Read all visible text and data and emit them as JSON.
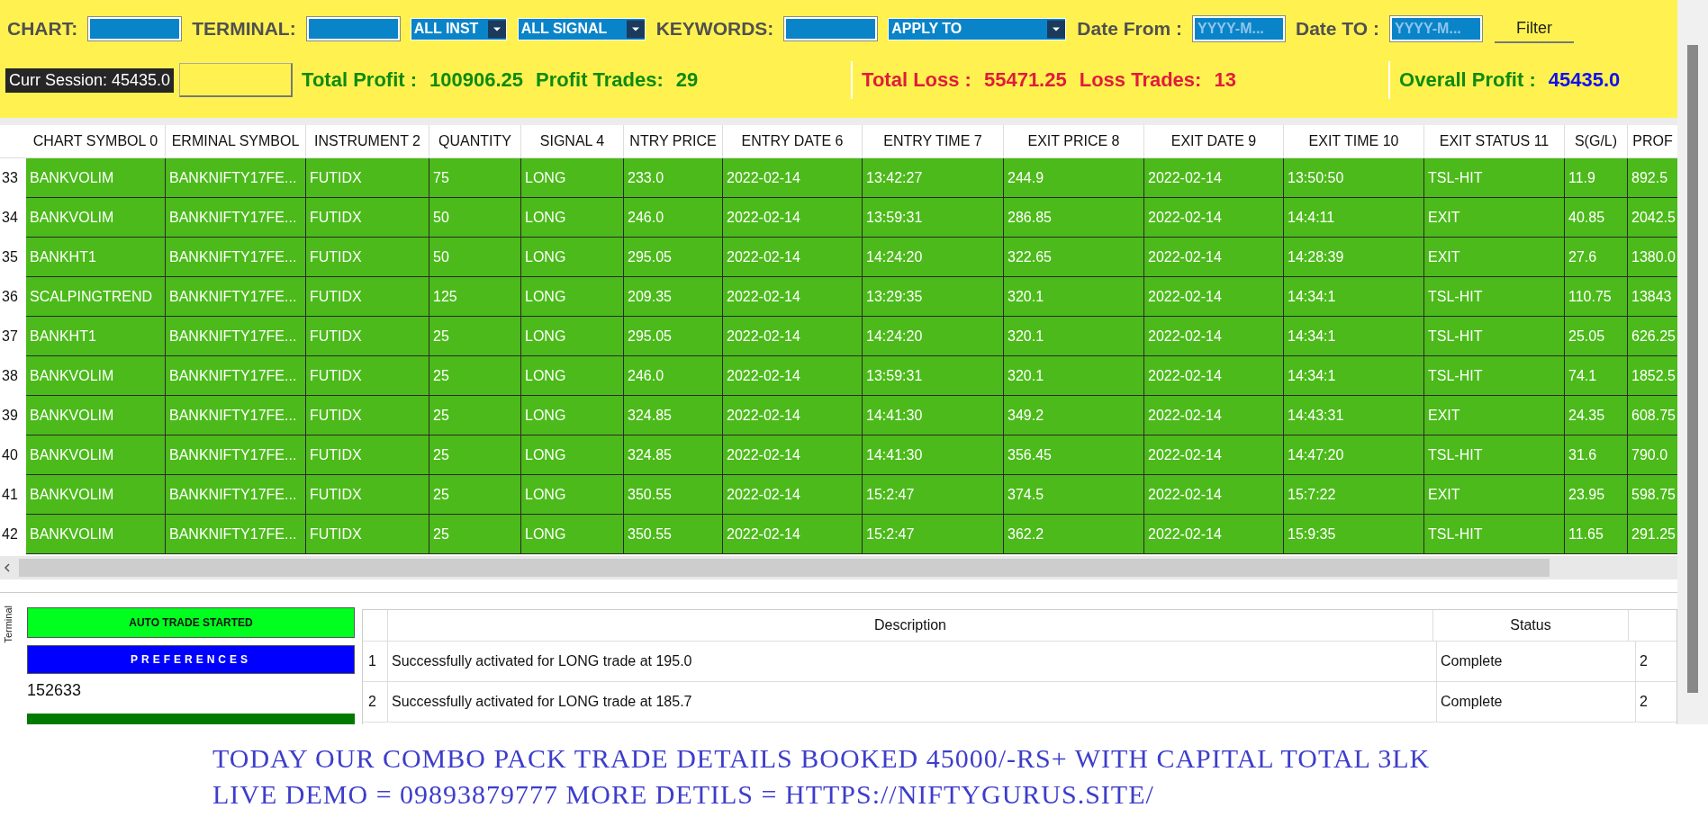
{
  "filter_bar": [
    {
      "kind": "label",
      "text": "CHART:"
    },
    {
      "kind": "field"
    },
    {
      "kind": "label",
      "text": "TERMINAL:"
    },
    {
      "kind": "field"
    },
    {
      "kind": "select",
      "text": "ALL INST"
    },
    {
      "kind": "select",
      "text": "ALL SIGNAL"
    },
    {
      "kind": "label",
      "text": "KEYWORDS:"
    },
    {
      "kind": "field"
    },
    {
      "kind": "select",
      "text": "APPLY TO"
    },
    {
      "kind": "label",
      "text": "Date From :"
    },
    {
      "kind": "date",
      "placeholder": "YYYY-M..."
    },
    {
      "kind": "label",
      "text": "Date TO :"
    },
    {
      "kind": "date",
      "placeholder": "YYYY-M..."
    },
    {
      "kind": "button",
      "text": "Filter"
    }
  ],
  "session": {
    "label": "Curr Session: 45435.0"
  },
  "stats": [
    {
      "kind": "profit",
      "items": [
        {
          "label": "Total Profit :",
          "value": "100906.25"
        },
        {
          "label": "Profit Trades:",
          "value": "29"
        }
      ]
    },
    {
      "kind": "loss",
      "items": [
        {
          "label": "Total Loss :",
          "value": "55471.25"
        },
        {
          "label": "Loss Trades:",
          "value": "13"
        }
      ]
    },
    {
      "kind": "overall",
      "items": [
        {
          "label": "Overall Profit :",
          "value": "45435.0"
        }
      ]
    }
  ],
  "table": {
    "columns": [
      "CHART SYMBOL 0",
      "ERMINAL SYMBOL",
      "INSTRUMENT 2",
      "QUANTITY",
      "SIGNAL 4",
      "NTRY PRICE",
      "ENTRY DATE 6",
      "ENTRY TIME 7",
      "EXIT PRICE 8",
      "EXIT DATE 9",
      "EXIT TIME 10",
      "EXIT STATUS 11",
      "S(G/L)",
      "PROF"
    ],
    "rows": [
      {
        "index": "33",
        "cells": [
          "BANKVOLIM",
          "BANKNIFTY17FE...",
          "FUTIDX",
          "75",
          "LONG",
          "233.0",
          "2022-02-14",
          "13:42:27",
          "244.9",
          "2022-02-14",
          "13:50:50",
          "TSL-HIT",
          "11.9",
          "892.5"
        ]
      },
      {
        "index": "34",
        "cells": [
          "BANKVOLIM",
          "BANKNIFTY17FE...",
          "FUTIDX",
          "50",
          "LONG",
          "246.0",
          "2022-02-14",
          "13:59:31",
          "286.85",
          "2022-02-14",
          "14:4:11",
          "EXIT",
          "40.85",
          "2042.5"
        ]
      },
      {
        "index": "35",
        "cells": [
          "BANKHT1",
          "BANKNIFTY17FE...",
          "FUTIDX",
          "50",
          "LONG",
          "295.05",
          "2022-02-14",
          "14:24:20",
          "322.65",
          "2022-02-14",
          "14:28:39",
          "EXIT",
          "27.6",
          "1380.0"
        ]
      },
      {
        "index": "36",
        "cells": [
          "SCALPINGTREND",
          "BANKNIFTY17FE...",
          "FUTIDX",
          "125",
          "LONG",
          "209.35",
          "2022-02-14",
          "13:29:35",
          "320.1",
          "2022-02-14",
          "14:34:1",
          "TSL-HIT",
          "110.75",
          "13843"
        ]
      },
      {
        "index": "37",
        "cells": [
          "BANKHT1",
          "BANKNIFTY17FE...",
          "FUTIDX",
          "25",
          "LONG",
          "295.05",
          "2022-02-14",
          "14:24:20",
          "320.1",
          "2022-02-14",
          "14:34:1",
          "TSL-HIT",
          "25.05",
          "626.25"
        ]
      },
      {
        "index": "38",
        "cells": [
          "BANKVOLIM",
          "BANKNIFTY17FE...",
          "FUTIDX",
          "25",
          "LONG",
          "246.0",
          "2022-02-14",
          "13:59:31",
          "320.1",
          "2022-02-14",
          "14:34:1",
          "TSL-HIT",
          "74.1",
          "1852.5"
        ]
      },
      {
        "index": "39",
        "cells": [
          "BANKVOLIM",
          "BANKNIFTY17FE...",
          "FUTIDX",
          "25",
          "LONG",
          "324.85",
          "2022-02-14",
          "14:41:30",
          "349.2",
          "2022-02-14",
          "14:43:31",
          "EXIT",
          "24.35",
          "608.75"
        ]
      },
      {
        "index": "40",
        "cells": [
          "BANKVOLIM",
          "BANKNIFTY17FE...",
          "FUTIDX",
          "25",
          "LONG",
          "324.85",
          "2022-02-14",
          "14:41:30",
          "356.45",
          "2022-02-14",
          "14:47:20",
          "TSL-HIT",
          "31.6",
          "790.0"
        ]
      },
      {
        "index": "41",
        "cells": [
          "BANKVOLIM",
          "BANKNIFTY17FE...",
          "FUTIDX",
          "25",
          "LONG",
          "350.55",
          "2022-02-14",
          "15:2:47",
          "374.5",
          "2022-02-14",
          "15:7:22",
          "EXIT",
          "23.95",
          "598.75"
        ]
      },
      {
        "index": "42",
        "cells": [
          "BANKVOLIM",
          "BANKNIFTY17FE...",
          "FUTIDX",
          "25",
          "LONG",
          "350.55",
          "2022-02-14",
          "15:2:47",
          "362.2",
          "2022-02-14",
          "15:9:35",
          "TSL-HIT",
          "11.65",
          "291.25"
        ]
      }
    ]
  },
  "side_tab": {
    "label": "Terminal"
  },
  "controls": [
    {
      "kind": "status",
      "text": "AUTO TRADE STARTED"
    },
    {
      "kind": "button",
      "text": "PREFERENCES"
    },
    {
      "kind": "value",
      "text": "152633"
    },
    {
      "kind": "bar"
    }
  ],
  "log": {
    "columns": [
      "Description",
      "Status"
    ],
    "rows": [
      {
        "index": "1",
        "description": "Successfully activated for LONG trade at 195.0",
        "status": "Complete",
        "extra": "2"
      },
      {
        "index": "2",
        "description": "Successfully activated for LONG trade at 185.7",
        "status": "Complete",
        "extra": "2"
      }
    ]
  },
  "caption": [
    "TODAY OUR COMBO PACK TRADE DETAILS BOOKED 45000/-RS+ WITH CAPITAL TOTAL 3LK",
    "LIVE DEMO = 09893879777 MORE DETILS = HTTPS://NIFTYGURUS.SITE/"
  ]
}
